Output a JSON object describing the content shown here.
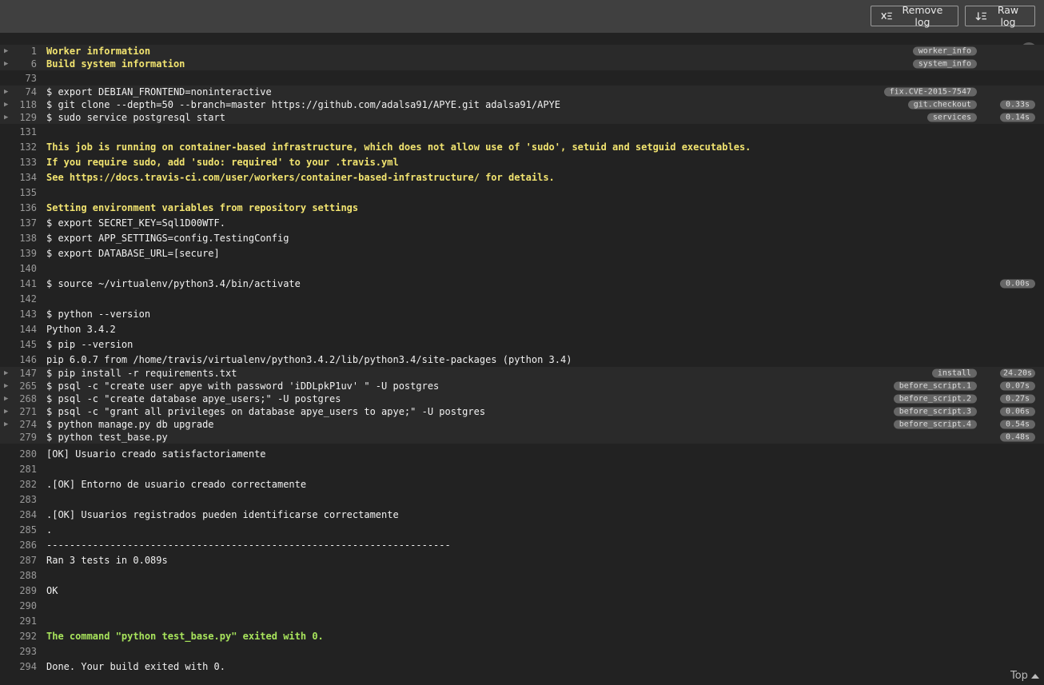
{
  "toolbar": {
    "remove_log_label": "Remove log",
    "raw_log_label": "Raw log"
  },
  "top_link": "Top",
  "log_lines": [
    {
      "n": "1",
      "text": "Worker information",
      "style": "yellow",
      "fold": true,
      "tag": "worker_info",
      "time": ""
    },
    {
      "n": "6",
      "text": "Build system information",
      "style": "yellow",
      "fold": true,
      "tag": "system_info",
      "time": ""
    },
    {
      "n": "73",
      "text": "",
      "style": "",
      "fold": false,
      "tag": "",
      "time": ""
    },
    {
      "n": "74",
      "text": "$ export DEBIAN_FRONTEND=noninteractive",
      "style": "",
      "fold": true,
      "tag": "fix.CVE-2015-7547",
      "time": ""
    },
    {
      "n": "118",
      "text": "$ git clone --depth=50 --branch=master https://github.com/adalsa91/APYE.git adalsa91/APYE",
      "style": "",
      "fold": true,
      "tag": "git.checkout",
      "time": "0.33s"
    },
    {
      "n": "129",
      "text": "$ sudo service postgresql start",
      "style": "",
      "fold": true,
      "tag": "services",
      "time": "0.14s"
    },
    {
      "n": "131",
      "text": "",
      "style": "",
      "fold": false,
      "tag": "",
      "time": ""
    },
    {
      "n": "132",
      "text": "This job is running on container-based infrastructure, which does not allow use of 'sudo', setuid and setguid executables.",
      "style": "yellow",
      "fold": false,
      "tag": "",
      "time": ""
    },
    {
      "n": "133",
      "text": "If you require sudo, add 'sudo: required' to your .travis.yml",
      "style": "yellow",
      "fold": false,
      "tag": "",
      "time": ""
    },
    {
      "n": "134",
      "text": "See https://docs.travis-ci.com/user/workers/container-based-infrastructure/ for details.",
      "style": "yellow",
      "fold": false,
      "tag": "",
      "time": ""
    },
    {
      "n": "135",
      "text": "",
      "style": "",
      "fold": false,
      "tag": "",
      "time": ""
    },
    {
      "n": "136",
      "text": "Setting environment variables from repository settings",
      "style": "yellow",
      "fold": false,
      "tag": "",
      "time": ""
    },
    {
      "n": "137",
      "text": "$ export SECRET_KEY=Sql1D00WTF.",
      "style": "",
      "fold": false,
      "tag": "",
      "time": ""
    },
    {
      "n": "138",
      "text": "$ export APP_SETTINGS=config.TestingConfig",
      "style": "",
      "fold": false,
      "tag": "",
      "time": ""
    },
    {
      "n": "139",
      "text": "$ export DATABASE_URL=[secure]",
      "style": "",
      "fold": false,
      "tag": "",
      "time": ""
    },
    {
      "n": "140",
      "text": "",
      "style": "",
      "fold": false,
      "tag": "",
      "time": ""
    },
    {
      "n": "141",
      "text": "$ source ~/virtualenv/python3.4/bin/activate",
      "style": "",
      "fold": false,
      "tag": "",
      "time": "0.00s"
    },
    {
      "n": "142",
      "text": "",
      "style": "",
      "fold": false,
      "tag": "",
      "time": ""
    },
    {
      "n": "143",
      "text": "$ python --version",
      "style": "",
      "fold": false,
      "tag": "",
      "time": ""
    },
    {
      "n": "144",
      "text": "Python 3.4.2",
      "style": "",
      "fold": false,
      "tag": "",
      "time": ""
    },
    {
      "n": "145",
      "text": "$ pip --version",
      "style": "",
      "fold": false,
      "tag": "",
      "time": ""
    },
    {
      "n": "146",
      "text": "pip 6.0.7 from /home/travis/virtualenv/python3.4.2/lib/python3.4/site-packages (python 3.4)",
      "style": "",
      "fold": false,
      "tag": "",
      "time": ""
    },
    {
      "n": "147",
      "text": "$ pip install -r requirements.txt",
      "style": "",
      "fold": true,
      "tag": "install",
      "time": "24.20s"
    },
    {
      "n": "265",
      "text": "$ psql -c \"create user apye with password 'iDDLpkP1uv' \" -U postgres",
      "style": "",
      "fold": true,
      "tag": "before_script.1",
      "time": "0.07s"
    },
    {
      "n": "268",
      "text": "$ psql -c \"create database apye_users;\" -U postgres",
      "style": "",
      "fold": true,
      "tag": "before_script.2",
      "time": "0.27s"
    },
    {
      "n": "271",
      "text": "$ psql -c \"grant all privileges on database apye_users to apye;\" -U postgres",
      "style": "",
      "fold": true,
      "tag": "before_script.3",
      "time": "0.06s"
    },
    {
      "n": "274",
      "text": "$ python manage.py db upgrade",
      "style": "",
      "fold": true,
      "tag": "before_script.4",
      "time": "0.54s"
    },
    {
      "n": "279",
      "text": "$ python test_base.py",
      "style": "",
      "fold": false,
      "tag": "",
      "time": "0.48s"
    },
    {
      "n": "280",
      "text": "[OK] Usuario creado satisfactoriamente",
      "style": "",
      "fold": false,
      "tag": "",
      "time": ""
    },
    {
      "n": "281",
      "text": "",
      "style": "",
      "fold": false,
      "tag": "",
      "time": ""
    },
    {
      "n": "282",
      "text": ".[OK] Entorno de usuario creado correctamente",
      "style": "",
      "fold": false,
      "tag": "",
      "time": ""
    },
    {
      "n": "283",
      "text": "",
      "style": "",
      "fold": false,
      "tag": "",
      "time": ""
    },
    {
      "n": "284",
      "text": ".[OK] Usuarios registrados pueden identificarse correctamente",
      "style": "",
      "fold": false,
      "tag": "",
      "time": ""
    },
    {
      "n": "285",
      "text": ".",
      "style": "",
      "fold": false,
      "tag": "",
      "time": ""
    },
    {
      "n": "286",
      "text": "----------------------------------------------------------------------",
      "style": "",
      "fold": false,
      "tag": "",
      "time": ""
    },
    {
      "n": "287",
      "text": "Ran 3 tests in 0.089s",
      "style": "",
      "fold": false,
      "tag": "",
      "time": ""
    },
    {
      "n": "288",
      "text": "",
      "style": "",
      "fold": false,
      "tag": "",
      "time": ""
    },
    {
      "n": "289",
      "text": "OK",
      "style": "",
      "fold": false,
      "tag": "",
      "time": ""
    },
    {
      "n": "290",
      "text": "",
      "style": "",
      "fold": false,
      "tag": "",
      "time": ""
    },
    {
      "n": "291",
      "text": "",
      "style": "",
      "fold": false,
      "tag": "",
      "time": ""
    },
    {
      "n": "292",
      "text": "The command \"python test_base.py\" exited with 0.",
      "style": "green",
      "fold": false,
      "tag": "",
      "time": ""
    },
    {
      "n": "293",
      "text": "",
      "style": "",
      "fold": false,
      "tag": "",
      "time": ""
    },
    {
      "n": "294",
      "text": "Done. Your build exited with 0.",
      "style": "",
      "fold": false,
      "tag": "",
      "time": ""
    }
  ]
}
